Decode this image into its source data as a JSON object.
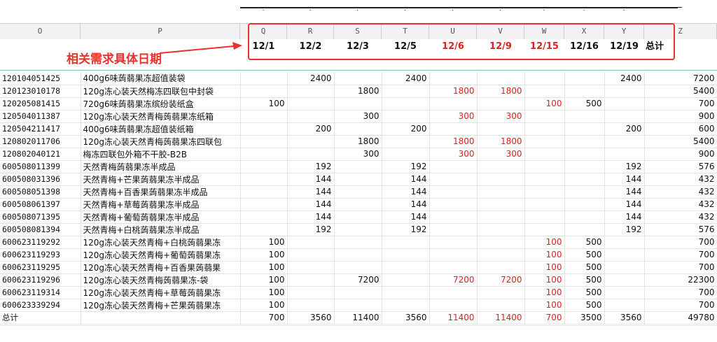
{
  "annotation": "相关需求具体日期",
  "columns": [
    "O",
    "P",
    "Q",
    "R",
    "S",
    "T",
    "U",
    "V",
    "W",
    "X",
    "Y",
    "Z"
  ],
  "dates": [
    {
      "label": "12/1",
      "red": false
    },
    {
      "label": "12/2",
      "red": false
    },
    {
      "label": "12/3",
      "red": false
    },
    {
      "label": "12/5",
      "red": false
    },
    {
      "label": "12/6",
      "red": true
    },
    {
      "label": "12/9",
      "red": true
    },
    {
      "label": "12/15",
      "red": true
    },
    {
      "label": "12/16",
      "red": false
    },
    {
      "label": "12/19",
      "red": false
    },
    {
      "label": "总计",
      "red": false
    }
  ],
  "redcols": [
    4,
    5,
    6
  ],
  "rows": [
    {
      "code": "120104051425",
      "name": "400g6味蒟蒻果冻超值装袋",
      "vals": [
        "",
        "2400",
        "",
        "2400",
        "",
        "",
        "",
        "",
        "2400",
        "7200"
      ]
    },
    {
      "code": "120123010178",
      "name": "120g冻心装天然梅冻四联包中封袋",
      "vals": [
        "",
        "",
        "1800",
        "",
        "1800",
        "1800",
        "",
        "",
        "",
        "5400"
      ]
    },
    {
      "code": "120205081415",
      "name": "720g6味蒟蒻果冻缤纷装纸盒",
      "vals": [
        "100",
        "",
        "",
        "",
        "",
        "",
        "100",
        "500",
        "",
        "700"
      ]
    },
    {
      "code": "120504011387",
      "name": "120g冻心装天然青梅蒟蒻果冻纸箱",
      "vals": [
        "",
        "",
        "300",
        "",
        "300",
        "300",
        "",
        "",
        "",
        "900"
      ]
    },
    {
      "code": "120504211417",
      "name": "400g6味蒟蒻果冻超值装纸箱",
      "vals": [
        "",
        "200",
        "",
        "200",
        "",
        "",
        "",
        "",
        "200",
        "600"
      ]
    },
    {
      "code": "120802011706",
      "name": "120g冻心装天然青梅蒟蒻果冻四联包",
      "vals": [
        "",
        "",
        "1800",
        "",
        "1800",
        "1800",
        "",
        "",
        "",
        "5400"
      ]
    },
    {
      "code": "120802040121",
      "name": "梅冻四联包外箱不干胶-B2B",
      "vals": [
        "",
        "",
        "300",
        "",
        "300",
        "300",
        "",
        "",
        "",
        "900"
      ]
    },
    {
      "code": "600508011399",
      "name": "天然青梅蒟蒻果冻半成品",
      "vals": [
        "",
        "192",
        "",
        "192",
        "",
        "",
        "",
        "",
        "192",
        "576"
      ]
    },
    {
      "code": "600508031396",
      "name": "天然青梅+芒果蒟蒻果冻半成品",
      "vals": [
        "",
        "144",
        "",
        "144",
        "",
        "",
        "",
        "",
        "144",
        "432"
      ]
    },
    {
      "code": "600508051398",
      "name": "天然青梅+百香果蒟蒻果冻半成品",
      "vals": [
        "",
        "144",
        "",
        "144",
        "",
        "",
        "",
        "",
        "144",
        "432"
      ]
    },
    {
      "code": "600508061397",
      "name": "天然青梅+草莓蒟蒻果冻半成品",
      "vals": [
        "",
        "144",
        "",
        "144",
        "",
        "",
        "",
        "",
        "144",
        "432"
      ]
    },
    {
      "code": "600508071395",
      "name": "天然青梅+葡萄蒟蒻果冻半成品",
      "vals": [
        "",
        "144",
        "",
        "144",
        "",
        "",
        "",
        "",
        "144",
        "432"
      ]
    },
    {
      "code": "600508081394",
      "name": "天然青梅+白桃蒟蒻果冻半成品",
      "vals": [
        "",
        "192",
        "",
        "192",
        "",
        "",
        "",
        "",
        "192",
        "576"
      ]
    },
    {
      "code": "600623119292",
      "name": "120g冻心装天然青梅+白桃蒟蒻果冻",
      "vals": [
        "100",
        "",
        "",
        "",
        "",
        "",
        "100",
        "500",
        "",
        "700"
      ]
    },
    {
      "code": "600623119293",
      "name": "120g冻心装天然青梅+葡萄蒟蒻果冻",
      "vals": [
        "100",
        "",
        "",
        "",
        "",
        "",
        "100",
        "500",
        "",
        "700"
      ]
    },
    {
      "code": "600623119295",
      "name": "120g冻心装天然青梅+百香果蒟蒻果",
      "vals": [
        "100",
        "",
        "",
        "",
        "",
        "",
        "100",
        "500",
        "",
        "700"
      ]
    },
    {
      "code": "600623119296",
      "name": "120g冻心装天然青梅蒟蒻果冻-袋",
      "vals": [
        "100",
        "",
        "7200",
        "",
        "7200",
        "7200",
        "100",
        "500",
        "",
        "22300"
      ]
    },
    {
      "code": "600623119314",
      "name": "120g冻心装天然青梅+草莓蒟蒻果冻",
      "vals": [
        "100",
        "",
        "",
        "",
        "",
        "",
        "100",
        "500",
        "",
        "700"
      ]
    },
    {
      "code": "600623339294",
      "name": "120g冻心装天然青梅+芒果蒟蒻果冻",
      "vals": [
        "100",
        "",
        "",
        "",
        "",
        "",
        "100",
        "500",
        "",
        "700"
      ]
    },
    {
      "code": "总计",
      "name": "",
      "vals": [
        "700",
        "3560",
        "11400",
        "3560",
        "11400",
        "11400",
        "700",
        "3500",
        "3560",
        "49780"
      ]
    }
  ]
}
